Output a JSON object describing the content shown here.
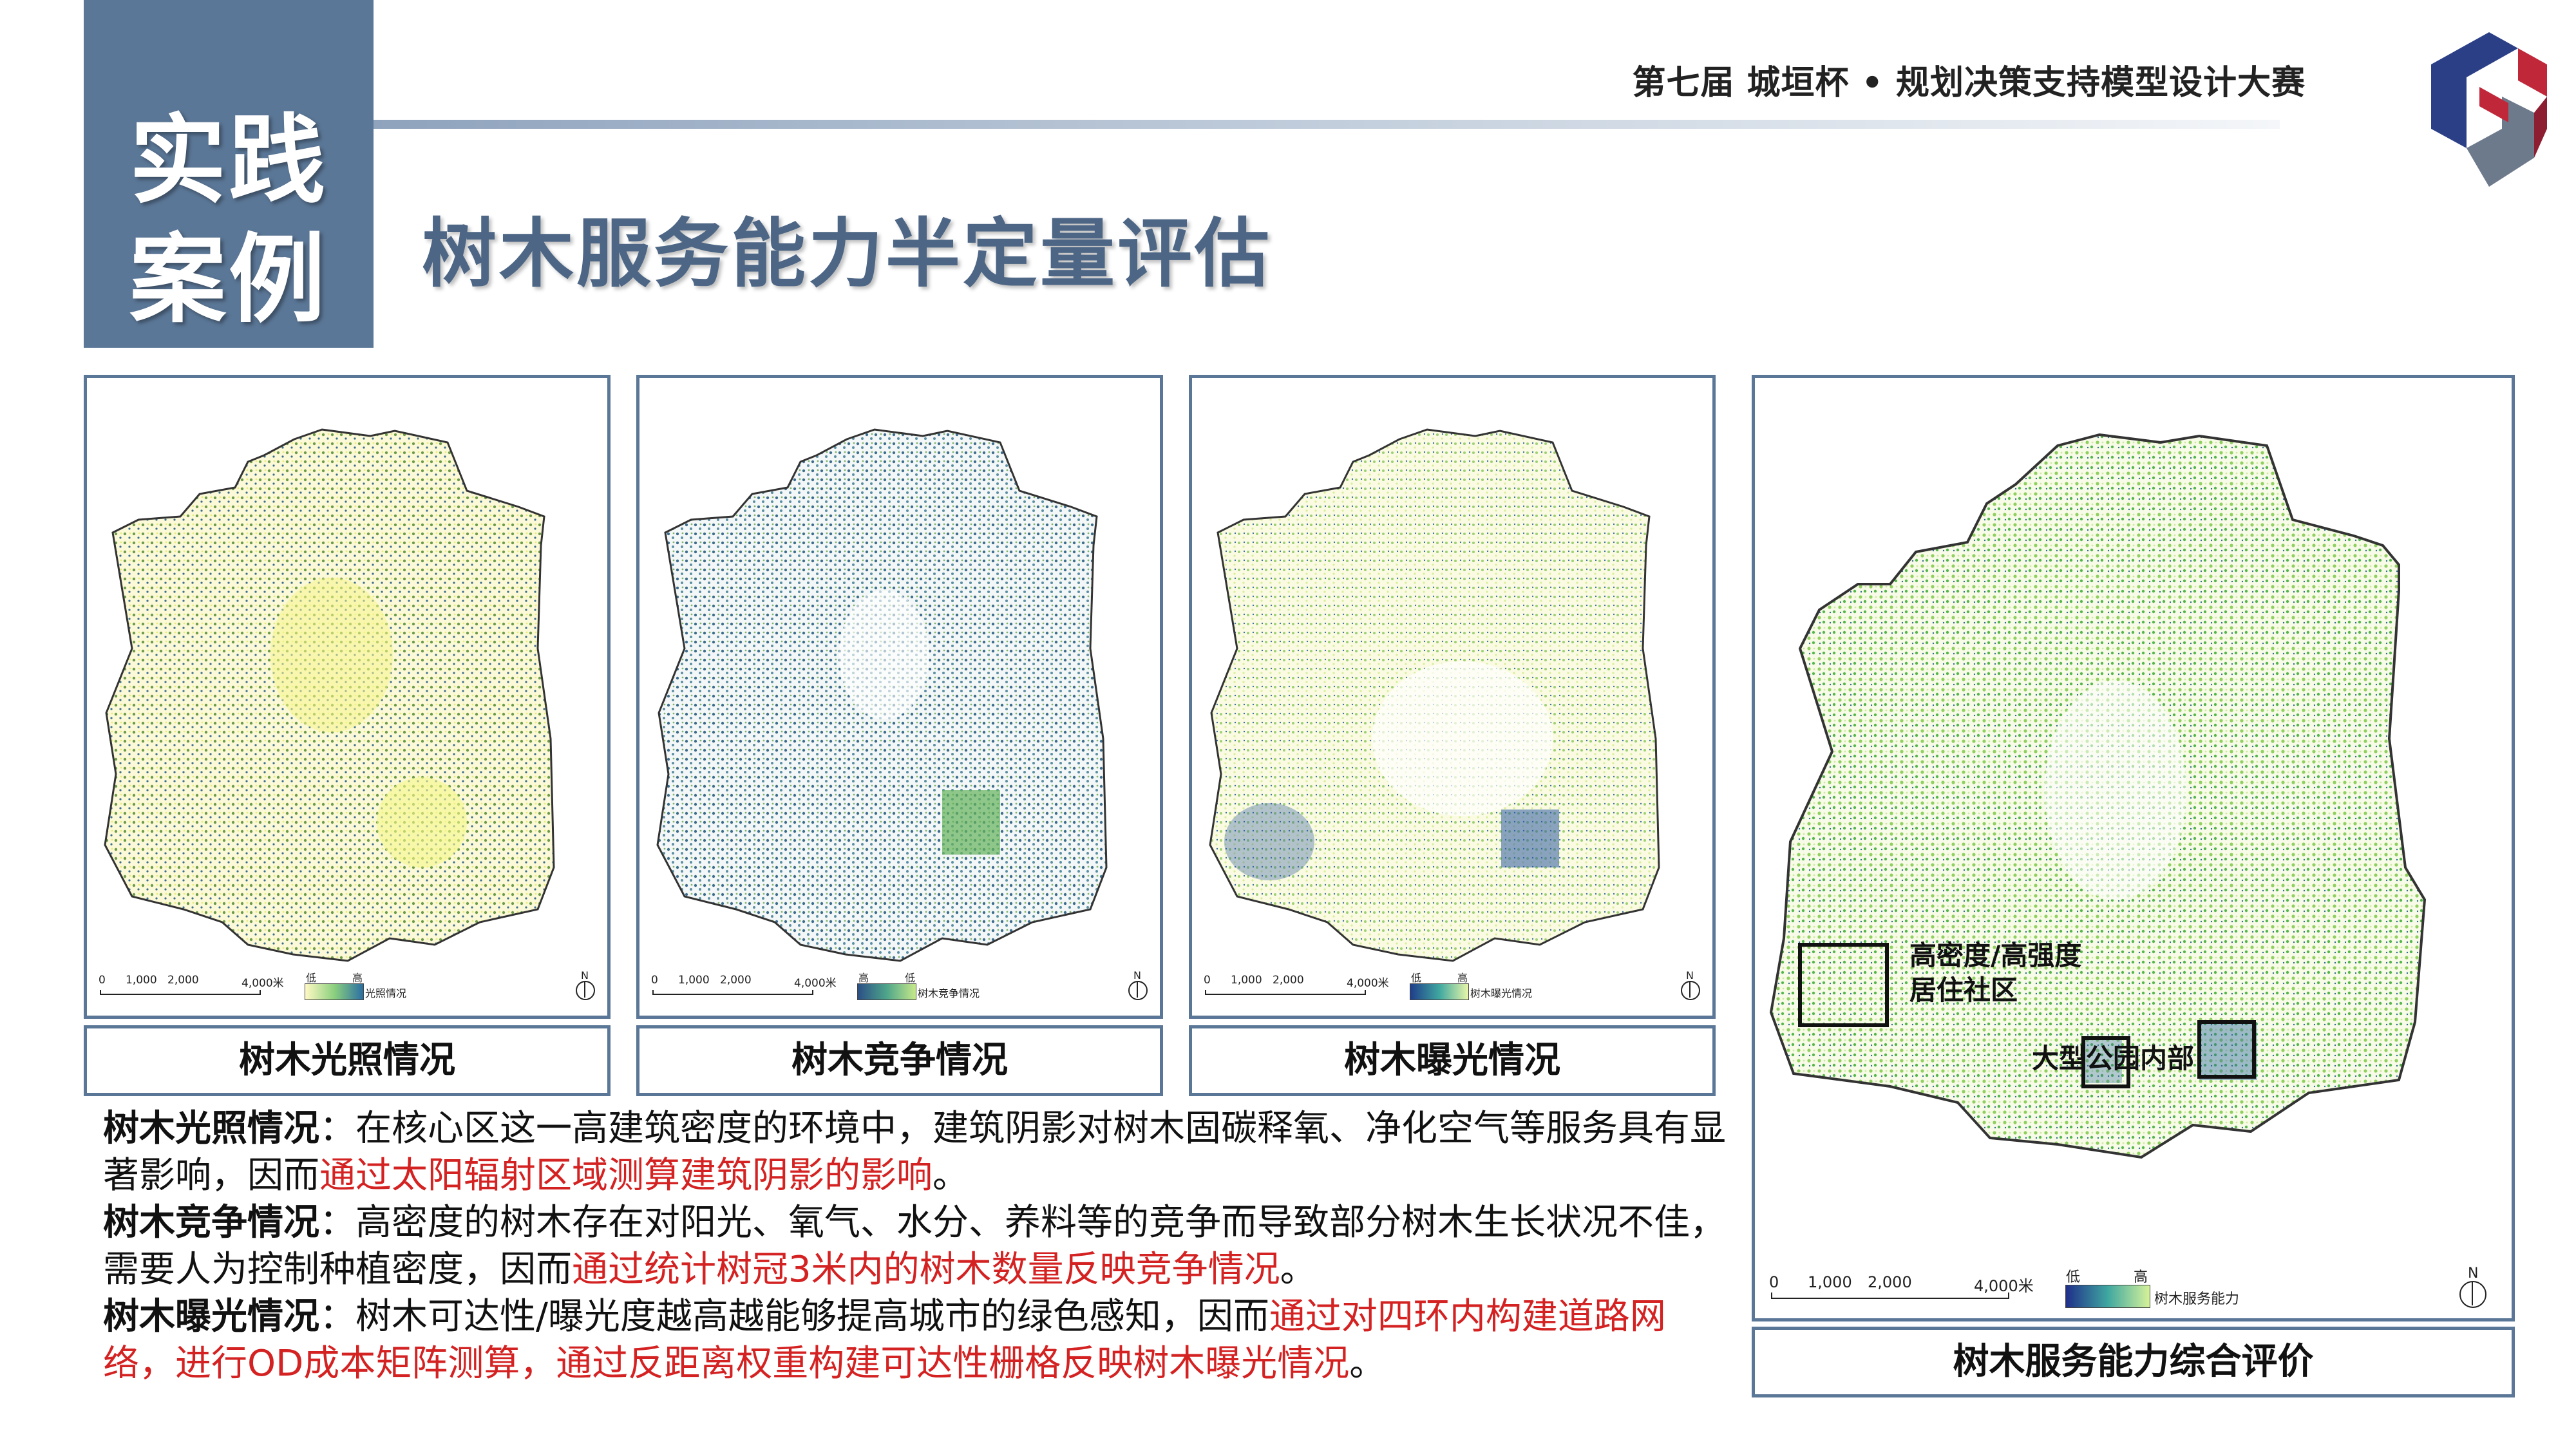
{
  "header": {
    "badge_line1": "实践",
    "badge_line2": "案例",
    "contest": "第七届 城垣杯 • 规划决策支持模型设计大赛",
    "title": "树木服务能力半定量评估"
  },
  "colors": {
    "accent": "#5b7797",
    "title": "#4d6685",
    "highlight": "#d42222"
  },
  "panels": [
    {
      "caption": "树木光照情况",
      "legend_low": "低",
      "legend_high": "高",
      "legend_name": "光照情况",
      "scale": [
        "0",
        "1,000",
        "2,000",
        "4,000米"
      ]
    },
    {
      "caption": "树木竞争情况",
      "legend_low": "高",
      "legend_high": "低",
      "legend_name": "树木竞争情况",
      "scale": [
        "0",
        "1,000",
        "2,000",
        "4,000米"
      ]
    },
    {
      "caption": "树木曝光情况",
      "legend_low": "低",
      "legend_high": "高",
      "legend_name": "树木曝光情况",
      "scale": [
        "0",
        "1,000",
        "2,000",
        "4,000米"
      ]
    }
  ],
  "main_panel": {
    "caption": "树木服务能力综合评价",
    "legend_low": "低",
    "legend_high": "高",
    "legend_name": "树木服务能力",
    "scale": [
      "0",
      "1,000",
      "2,000",
      "4,000米"
    ],
    "annotations": [
      "高密度/高强度",
      "居住社区",
      "大型公园内部"
    ]
  },
  "description": [
    {
      "label": "树木光照情况",
      "sep": "：",
      "normal": "在核心区这一高建筑密度的环境中，建筑阴影对树木固碳释氧、净化空气等服务具有显著影响，因而",
      "red": "通过太阳辐射区域测算建筑阴影的影响",
      "end": "。"
    },
    {
      "label": "树木竞争情况",
      "sep": "：",
      "normal": "高密度的树木存在对阳光、氧气、水分、养料等的竞争而导致部分树木生长状况不佳，需要人为控制种植密度，因而",
      "red": "通过统计树冠3米内的树木数量反映竞争情况",
      "end": "。"
    },
    {
      "label": "树木曝光情况",
      "sep": "：",
      "normal": "树木可达性/曝光度越高越能够提高城市的绿色感知，因而",
      "red": "通过对四环内构建道路网络，进行OD成本矩阵测算，通过反距离权重构建可达性栅格反映树木曝光情况",
      "end": "。"
    }
  ],
  "north_label": "N"
}
